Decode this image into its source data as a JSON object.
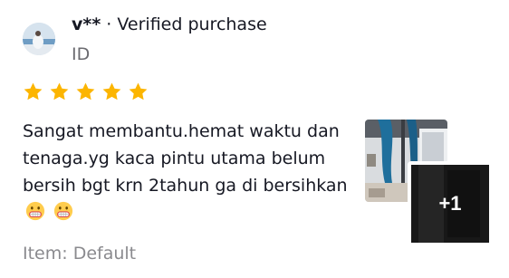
{
  "reviewer": {
    "name": "v**",
    "separator": " · ",
    "verified_label": "Verified purchase",
    "country": "ID"
  },
  "rating": {
    "value": 5,
    "max": 5,
    "star_color": "#fcb500"
  },
  "review": {
    "text": "Sangat membantu.hemat waktu dan tenaga.yg kaca pintu utama belum bersih bgt krn 2tahun ga di bersihkan",
    "emojis": [
      "grimacing-face-icon",
      "grimacing-face-icon"
    ]
  },
  "item": {
    "label": "Item: Default"
  },
  "photos": {
    "more_count": "+1"
  }
}
